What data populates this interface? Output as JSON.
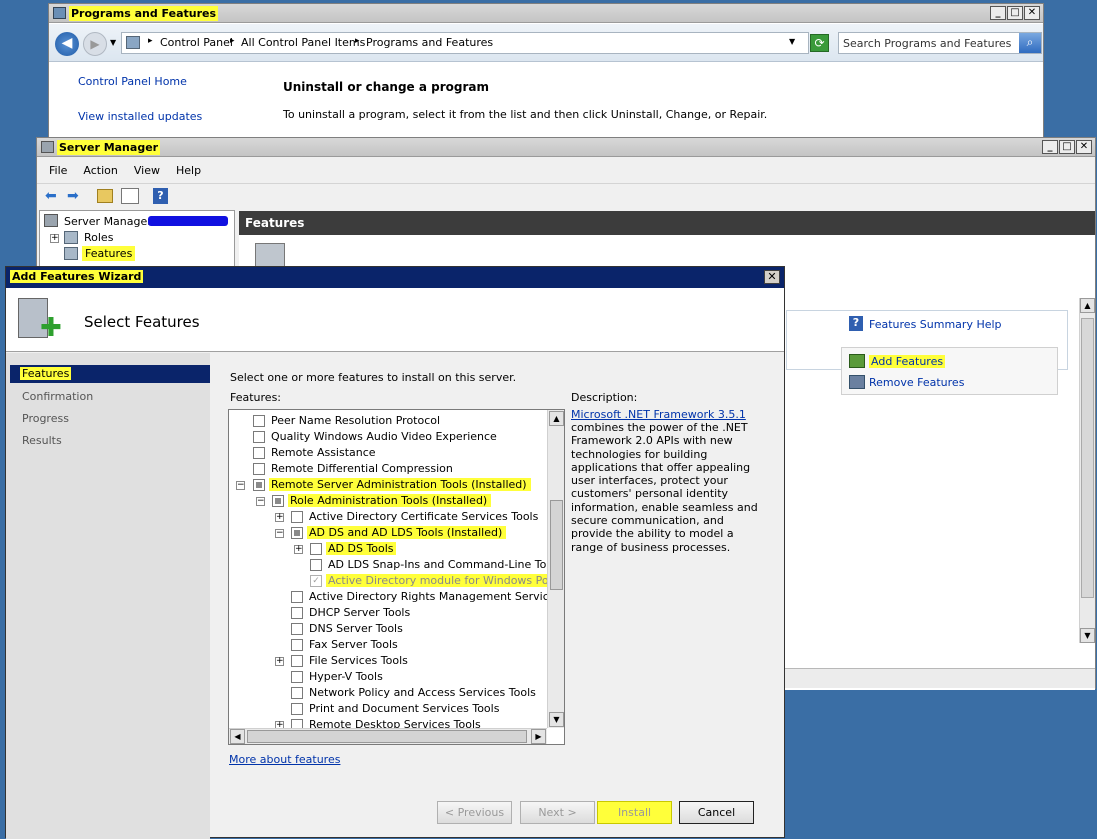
{
  "programs_window": {
    "title": "Programs and Features",
    "address": {
      "part1": "Control Panel",
      "part2": "All Control Panel Items",
      "part3": "Programs and Features"
    },
    "search_placeholder": "Search Programs and Features",
    "sidebar_home": "Control Panel Home",
    "sidebar_updates": "View installed updates",
    "heading": "Uninstall or change a program",
    "description": "To uninstall a program, select it from the list and then click Uninstall, Change, or Repair."
  },
  "server_manager": {
    "title": "Server Manager",
    "menu": [
      "File",
      "Action",
      "View",
      "Help"
    ],
    "tree": {
      "root": "Server Manager",
      "roles": "Roles",
      "features": "Features"
    },
    "header": "Features",
    "help_link": "Features Summary Help",
    "add_features": "Add Features",
    "remove_features": "Remove Features"
  },
  "wizard": {
    "title": "Add Features Wizard",
    "heading": "Select Features",
    "steps": [
      "Features",
      "Confirmation",
      "Progress",
      "Results"
    ],
    "instruction": "Select one or more features to install on this server.",
    "features_label": "Features:",
    "description_label": "Description:",
    "description_link": "Microsoft .NET Framework 3.5.1",
    "description_text": "combines the power of the .NET Framework 2.0 APIs with new technologies for building applications that offer appealing user interfaces, protect your customers' personal identity information, enable seamless and secure communication, and provide the ability to model a range of business processes.",
    "items": [
      {
        "label": "Peer Name Resolution Protocol"
      },
      {
        "label": "Quality Windows Audio Video Experience"
      },
      {
        "label": "Remote Assistance"
      },
      {
        "label": "Remote Differential Compression"
      },
      {
        "label": "Remote Server Administration Tools  (Installed)"
      },
      {
        "label": "Role Administration Tools  (Installed)"
      },
      {
        "label": "Active Directory Certificate Services Tools"
      },
      {
        "label": "AD DS and AD LDS Tools  (Installed)"
      },
      {
        "label": "AD DS Tools"
      },
      {
        "label": "AD LDS Snap-Ins and Command-Line Tools"
      },
      {
        "label": "Active Directory module for Windows PowerSh"
      },
      {
        "label": "Active Directory Rights Management Services Too"
      },
      {
        "label": "DHCP Server Tools"
      },
      {
        "label": "DNS Server Tools"
      },
      {
        "label": "Fax Server Tools"
      },
      {
        "label": "File Services Tools"
      },
      {
        "label": "Hyper-V Tools"
      },
      {
        "label": "Network Policy and Access Services Tools"
      },
      {
        "label": "Print and Document Services Tools"
      },
      {
        "label": "Remote Desktop Services Tools"
      }
    ],
    "more_link": "More about features",
    "buttons": {
      "previous": "< Previous",
      "next": "Next >",
      "install": "Install",
      "cancel": "Cancel"
    }
  }
}
